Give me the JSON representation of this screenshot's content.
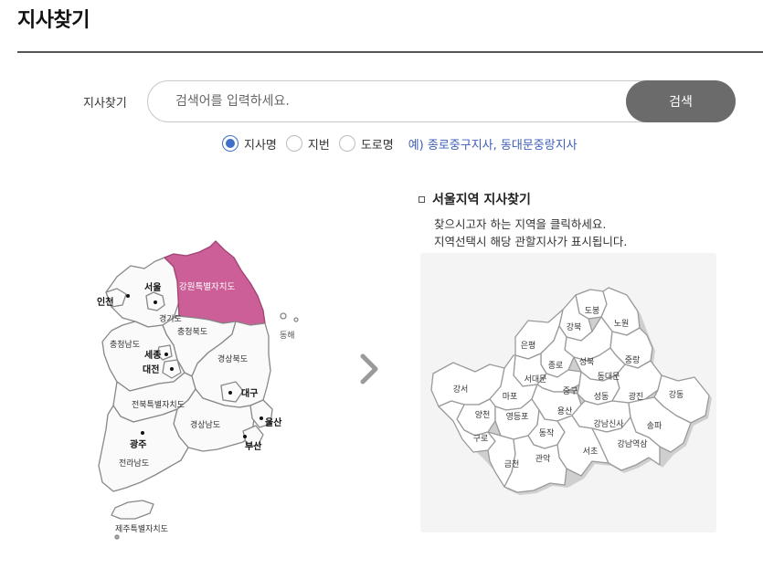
{
  "page": {
    "title": "지사찾기"
  },
  "search": {
    "label": "지사찾기",
    "placeholder": "검색어를 입력하세요.",
    "button_label": "검색"
  },
  "search_type": {
    "options": [
      {
        "label": "지사명",
        "selected": true
      },
      {
        "label": "지번",
        "selected": false
      },
      {
        "label": "도로명",
        "selected": false
      }
    ],
    "example": "예) 종로중구지사, 동대문중랑지사"
  },
  "korea_map": {
    "highlight_color": "#cc5f97",
    "regions": {
      "seoul": "서울",
      "incheon": "인천",
      "gyeonggi": "경기도",
      "gangwon": "강원특별자치도",
      "chungbuk": "충청북도",
      "chungnam": "충청남도",
      "sejong": "세종",
      "daejeon": "대전",
      "gyeongbuk": "경상북도",
      "daegu": "대구",
      "jeonbuk": "전북특별자치도",
      "gyeongnam": "경상남도",
      "ulsan": "울산",
      "busan": "부산",
      "gwangju": "광주",
      "jeonnam": "전라남도",
      "jeju": "제주특별자치도",
      "east_sea": "동해"
    }
  },
  "region_panel": {
    "title": "서울지역 지사찾기",
    "desc_line1": "찾으시고자 하는 지역을 클릭하세요.",
    "desc_line2": "지역선택시 해당 관할지사가 표시됩니다."
  },
  "seoul_map": {
    "districts": {
      "dobong": "도봉",
      "nowon": "노원",
      "gangbuk": "강북",
      "eunpyeong": "은평",
      "seongbuk": "성북",
      "jungnang": "중랑",
      "jongno": "종로",
      "seodaemun": "서대문",
      "dongdaemun": "동대문",
      "gangseo": "강서",
      "mapo": "마포",
      "jung": "중구",
      "seongdong": "성동",
      "gwangjin": "광진",
      "gangdong": "강동",
      "yangcheon": "양천",
      "yeongdeungpo": "영등포",
      "yongsan": "용산",
      "guro": "구로",
      "dongjak": "동작",
      "gangnam": "강남신사",
      "songpa": "송파",
      "seocho": "서초",
      "gangnam_station": "강남역삼",
      "geumcheon": "금천",
      "gwanak": "관악"
    }
  }
}
